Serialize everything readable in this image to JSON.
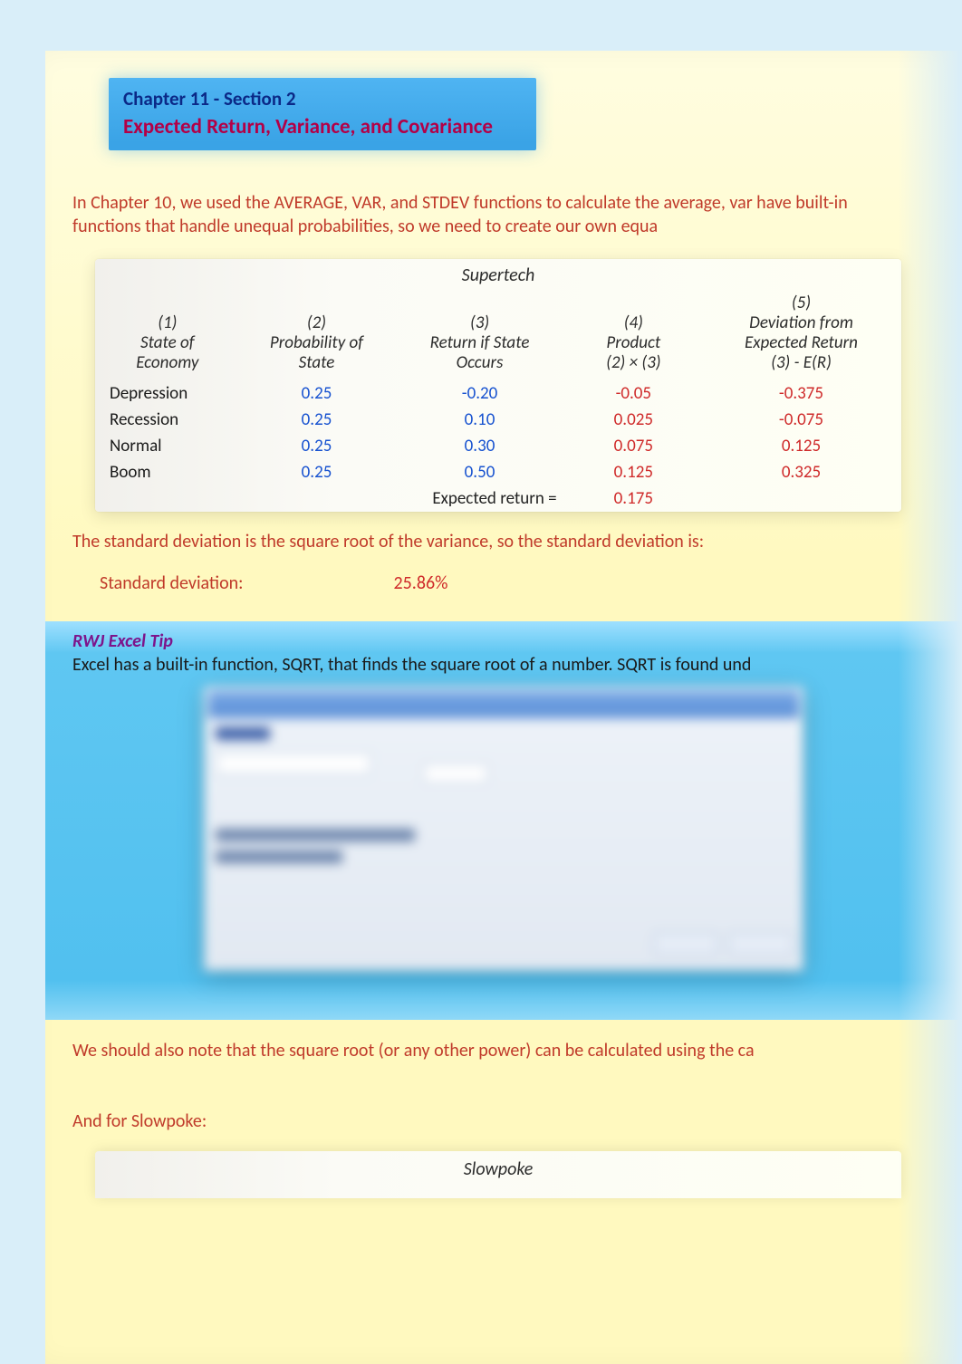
{
  "title": {
    "line1": "Chapter 11 - Section 2",
    "line2": "Expected Return, Variance, and Covariance"
  },
  "intro": "In Chapter 10, we used the AVERAGE, VAR, and STDEV functions to calculate the average, var have built-in functions that handle unequal probabilities, so we need to create our own equa",
  "table1": {
    "caption": "Supertech",
    "headers": {
      "c1": "(1)\nState of\nEconomy",
      "c2": "(2)\nProbability of\nState",
      "c3": "(3)\nReturn if State\nOccurs",
      "c4": "(4)\nProduct\n(2) × (3)",
      "c5": "(5)\nDeviation from\nExpected Return\n(3) - E(R)"
    },
    "rows": [
      {
        "state": "Depression",
        "prob": "0.25",
        "ret": "-0.20",
        "prod": "-0.05",
        "dev": "-0.375"
      },
      {
        "state": "Recession",
        "prob": "0.25",
        "ret": "0.10",
        "prod": "0.025",
        "dev": "-0.075"
      },
      {
        "state": "Normal",
        "prob": "0.25",
        "ret": "0.30",
        "prod": "0.075",
        "dev": "0.125"
      },
      {
        "state": "Boom",
        "prob": "0.25",
        "ret": "0.50",
        "prod": "0.125",
        "dev": "0.325"
      }
    ],
    "expected_label": "Expected return =",
    "expected_value": "0.175"
  },
  "stddev_sentence": "The standard deviation is the square root of the variance, so the standard deviation is:",
  "stddev_label": "Standard deviation:",
  "stddev_value": "25.86%",
  "tip": {
    "title": "RWJ Excel Tip",
    "text": "Excel has a built-in function, SQRT, that finds the square root of a number. SQRT is found und"
  },
  "note2": "We should also note that the square root (or any other power) can be calculated using the ca",
  "slowpoke_intro": "And for Slowpoke:",
  "table2_caption": "Slowpoke",
  "chart_data": {
    "type": "table",
    "title": "Supertech — Expected Return computation",
    "columns": [
      "State of Economy",
      "Probability of State",
      "Return if State Occurs",
      "Product (2)×(3)",
      "Deviation from Expected Return (3)-E(R)"
    ],
    "rows": [
      [
        "Depression",
        0.25,
        -0.2,
        -0.05,
        -0.375
      ],
      [
        "Recession",
        0.25,
        0.1,
        0.025,
        -0.075
      ],
      [
        "Normal",
        0.25,
        0.3,
        0.075,
        0.125
      ],
      [
        "Boom",
        0.25,
        0.5,
        0.125,
        0.325
      ]
    ],
    "summary": {
      "expected_return": 0.175,
      "standard_deviation": 0.2586
    }
  }
}
